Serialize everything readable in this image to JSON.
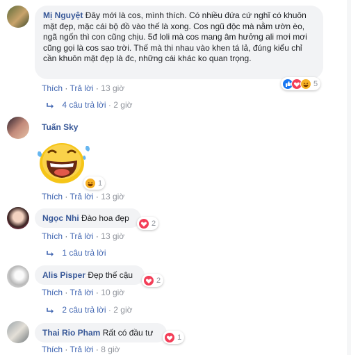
{
  "actions": {
    "like": "Thích",
    "reply": "Trả lời",
    "sep": "·"
  },
  "comments": [
    {
      "name": "Mị Nguyệt",
      "text": "Đây mới là cos, mình thích. Có nhiều đứa cứ nghĩ có khuôn mặt đẹp, mặc cái bộ đồ vào thế là xong. Cos ngũ độc mà nằm ườn èo, ngã ngốn thì con cũng chịu. 5đ loli mà cos mang âm hưởng ali mơi mơi cũng gọi là cos sao trời. Thế mà thi nhau vào khen tá lả, đúng kiểu chỉ cần khuôn mặt đẹp là đc, những cái khác ko quan trọng.",
      "time": "13 giờ",
      "reactions_count": "5",
      "replies": "4 câu trả lời",
      "replies_time": "2 giờ"
    },
    {
      "name": "Tuấn Sky",
      "text": "",
      "time": "13 giờ",
      "reactions_count": "1",
      "sticker": "laughing-face-sticker"
    },
    {
      "name": "Ngọc Nhi",
      "text": "Đào hoa đẹp",
      "time": "13 giờ",
      "reactions_count": "2",
      "replies": "1 câu trả lời"
    },
    {
      "name": "Alis Pisper",
      "text": "Đẹp thế cậu",
      "time": "10 giờ",
      "reactions_count": "2",
      "replies": "2 câu trả lời",
      "replies_time": "2 giờ"
    },
    {
      "name": "Thai Rio Pham",
      "text": "Rất có đầu tư",
      "time": "8 giờ",
      "reactions_count": "1"
    }
  ],
  "colors": {
    "name": "#385898",
    "link": "#4267b2",
    "bubble": "#f2f3f5",
    "muted": "#90949c",
    "love": "#f33e58",
    "like": "#1877f2",
    "haha": "#f7b125"
  }
}
